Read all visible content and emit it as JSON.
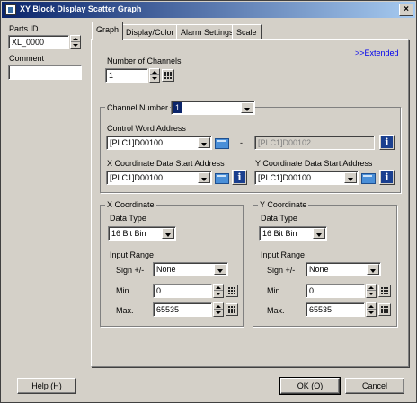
{
  "window": {
    "title": "XY Block Display Scatter Graph",
    "close_glyph": "×"
  },
  "left": {
    "parts_id_label": "Parts ID",
    "parts_id_value": "XL_0000",
    "comment_label": "Comment",
    "comment_value": ""
  },
  "tabs": [
    "Graph",
    "Display/Color",
    "Alarm Settings",
    "Scale"
  ],
  "graph": {
    "extended_link": ">>Extended",
    "num_channels_label": "Number of Channels",
    "num_channels_value": "1",
    "channel_number_label": "Channel Number",
    "channel_number_value": "1",
    "control_word_label": "Control Word Address",
    "control_word_value": "[PLC1]D00100",
    "control_word_dash": "-",
    "control_word_end_value": "[PLC1]D00102",
    "x_start_label": "X Coordinate Data Start Address",
    "x_start_value": "[PLC1]D00100",
    "y_start_label": "Y Coordinate Data Start Address",
    "y_start_value": "[PLC1]D00100",
    "x_coord": {
      "title": "X Coordinate",
      "data_type_label": "Data Type",
      "data_type_value": "16 Bit Bin",
      "input_range_label": "Input Range",
      "sign_label": "Sign +/-",
      "sign_value": "None",
      "min_label": "Min.",
      "min_value": "0",
      "max_label": "Max.",
      "max_value": "65535"
    },
    "y_coord": {
      "title": "Y Coordinate",
      "data_type_label": "Data Type",
      "data_type_value": "16 Bit Bin",
      "input_range_label": "Input Range",
      "sign_label": "Sign +/-",
      "sign_value": "None",
      "min_label": "Min.",
      "min_value": "0",
      "max_label": "Max.",
      "max_value": "65535"
    }
  },
  "footer": {
    "help_label": "Help (H)",
    "ok_label": "OK (O)",
    "cancel_label": "Cancel"
  },
  "colors": {
    "titlebar_start": "#0a246a",
    "titlebar_end": "#a6caf0",
    "face": "#d4d0c8",
    "link": "#0000ee"
  }
}
